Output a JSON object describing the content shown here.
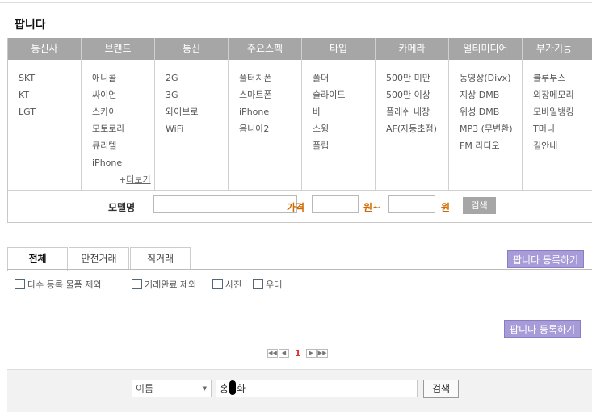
{
  "page": {
    "title": "팝니다"
  },
  "filter": {
    "columns": [
      {
        "header": "통신사",
        "items": [
          "SKT",
          "KT",
          "LGT"
        ]
      },
      {
        "header": "브랜드",
        "items": [
          "애니콜",
          "싸이언",
          "스카이",
          "모토로라",
          "큐리텔",
          "iPhone"
        ]
      },
      {
        "header": "통신",
        "items": [
          "2G",
          "3G",
          "와이브로",
          "WiFi"
        ]
      },
      {
        "header": "주요스펙",
        "items": [
          "풀터치폰",
          "스마트폰",
          "iPhone",
          "옴니아2"
        ]
      },
      {
        "header": "타입",
        "items": [
          "폴더",
          "슬라이드",
          "바",
          "스윙",
          "플립"
        ]
      },
      {
        "header": "카메라",
        "items": [
          "500만 미만",
          "500만 이상",
          "플래쉬 내장",
          "AF(자동초점)"
        ]
      },
      {
        "header": "멀티미디어",
        "items": [
          "동영상(Divx)",
          "지상 DMB",
          "위성 DMB",
          "MP3 (무변환)",
          "FM 라디오"
        ]
      },
      {
        "header": "부가기능",
        "items": [
          "블루투스",
          "외장메모리",
          "모바일뱅킹",
          "T머니",
          "길안내"
        ]
      }
    ],
    "more_prefix": "+",
    "more_label": "더보기",
    "model_label": "모델명",
    "model_value": "",
    "price_label": "가격",
    "price_from": "",
    "unit_won_tilde": "원~",
    "price_to": "",
    "unit_won": "원",
    "search_label": "검색"
  },
  "tabs": [
    {
      "label": "전체",
      "active": true
    },
    {
      "label": "안전거래",
      "active": false
    },
    {
      "label": "직거래",
      "active": false
    }
  ],
  "register_label": "팝니다 등록하기",
  "checkboxes": [
    {
      "label": "다수 등록 물품 제외",
      "checked": false
    },
    {
      "label": "거래완료 제외",
      "checked": false
    },
    {
      "label": "사진",
      "checked": false
    },
    {
      "label": "우대",
      "checked": false
    }
  ],
  "pagination": {
    "first": "◀◀",
    "prev": "◀",
    "current": "1",
    "next": "▶",
    "last": "▶▶"
  },
  "search_bar": {
    "select_value": "이름",
    "input_before": "홍",
    "input_after": "화",
    "button_label": "검색"
  },
  "colors": {
    "header_gray": "#a6a6a6",
    "price_orange": "#d06a00",
    "register_purple": "#a89cd8",
    "page_red": "#d33333"
  }
}
